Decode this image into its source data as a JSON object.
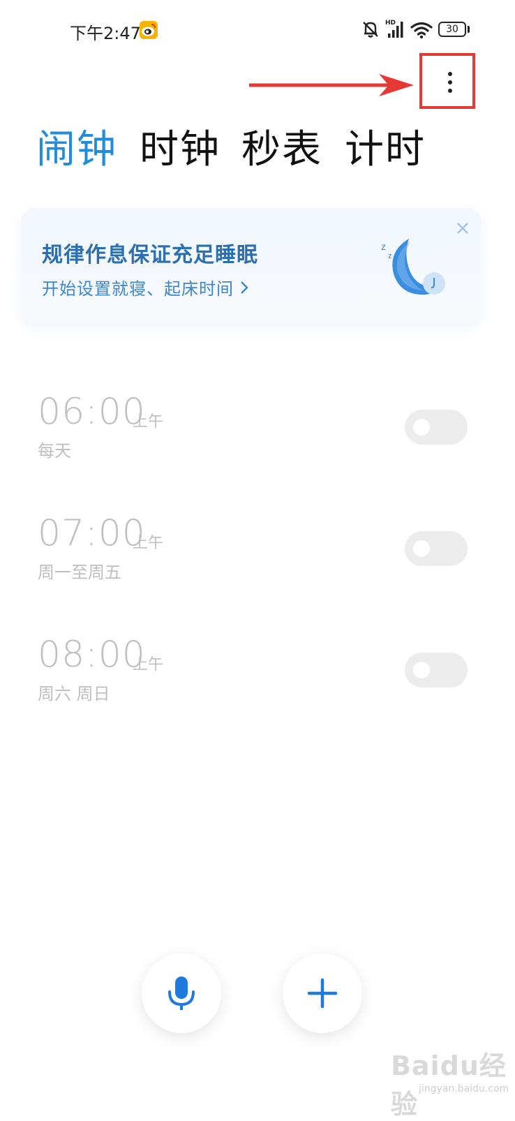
{
  "status_bar": {
    "time": "下午2:47",
    "network_label": "HD",
    "battery": "30"
  },
  "toolbar": {
    "more_icon": "more-vertical-icon"
  },
  "tabs": [
    {
      "label": "闹钟",
      "active": true
    },
    {
      "label": "时钟",
      "active": false
    },
    {
      "label": "秒表",
      "active": false
    },
    {
      "label": "计时",
      "active": false
    }
  ],
  "promo": {
    "title": "规律作息保证充足睡眠",
    "link": "开始设置就寝、起床时间",
    "icon": "moon-sleep-icon"
  },
  "alarms": [
    {
      "time": "06:00",
      "ampm": "上午",
      "repeat": "每天",
      "enabled": false
    },
    {
      "time": "07:00",
      "ampm": "上午",
      "repeat": "周一至周五",
      "enabled": false
    },
    {
      "time": "08:00",
      "ampm": "上午",
      "repeat": "周六 周日",
      "enabled": false
    }
  ],
  "fabs": {
    "voice_icon": "microphone-icon",
    "add_icon": "plus-icon"
  },
  "watermark": {
    "brand": "Baidu经验",
    "url": "jingyan.baidu.com"
  },
  "colors": {
    "accent": "#1f8cde",
    "annotation": "#e53935",
    "disabled_text": "#bfbfbf"
  }
}
